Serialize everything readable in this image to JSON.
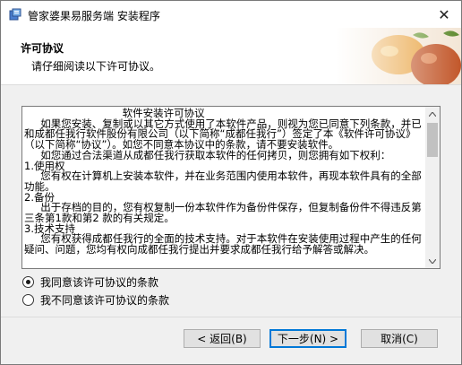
{
  "window": {
    "title": "管家婆果易服务端 安装程序",
    "close_glyph": "✕"
  },
  "header": {
    "title": "许可协议",
    "subtitle": "请仔细阅读以下许可协议。"
  },
  "license": {
    "text": "                              软件安装许可协议\n     如果您安装、复制或以其它方式使用了本软件产品，则视为您已同意下列条款，并已和成都任我行软件股份有限公司（以下简称“成都任我行”）签定了本《软件许可协议》（以下简称“协议”）。如您不同意本协议中的条款，请不要安装软件。\n     如您通过合法渠道从成都任我行获取本软件的任何拷贝，则您拥有如下权利：\n1.使用权\n     您有权在计算机上安装本软件，并在业务范围内使用本软件，再现本软件具有的全部功能。\n2.备份\n     出于存档的目的，您有权复制一份本软件作为备份件保存，但复制备份件不得违反第三条第1款和第2 款的有关规定。\n3.技术支持\n     您有权获得成都任我行的全面的技术支持。对于本软件在安装使用过程中产生的任何疑问、问题，您均有权向成都任我行提出并要求成都任我行给予解答或解决。"
  },
  "options": {
    "agree": "我同意该许可协议的条款",
    "disagree": "我不同意该许可协议的条款",
    "selected": "agree"
  },
  "buttons": {
    "back": "< 返回(B)",
    "next": "下一步(N) >",
    "cancel": "取消(C)"
  },
  "icons": {
    "app": "installer-app-icon",
    "close": "close-icon"
  }
}
